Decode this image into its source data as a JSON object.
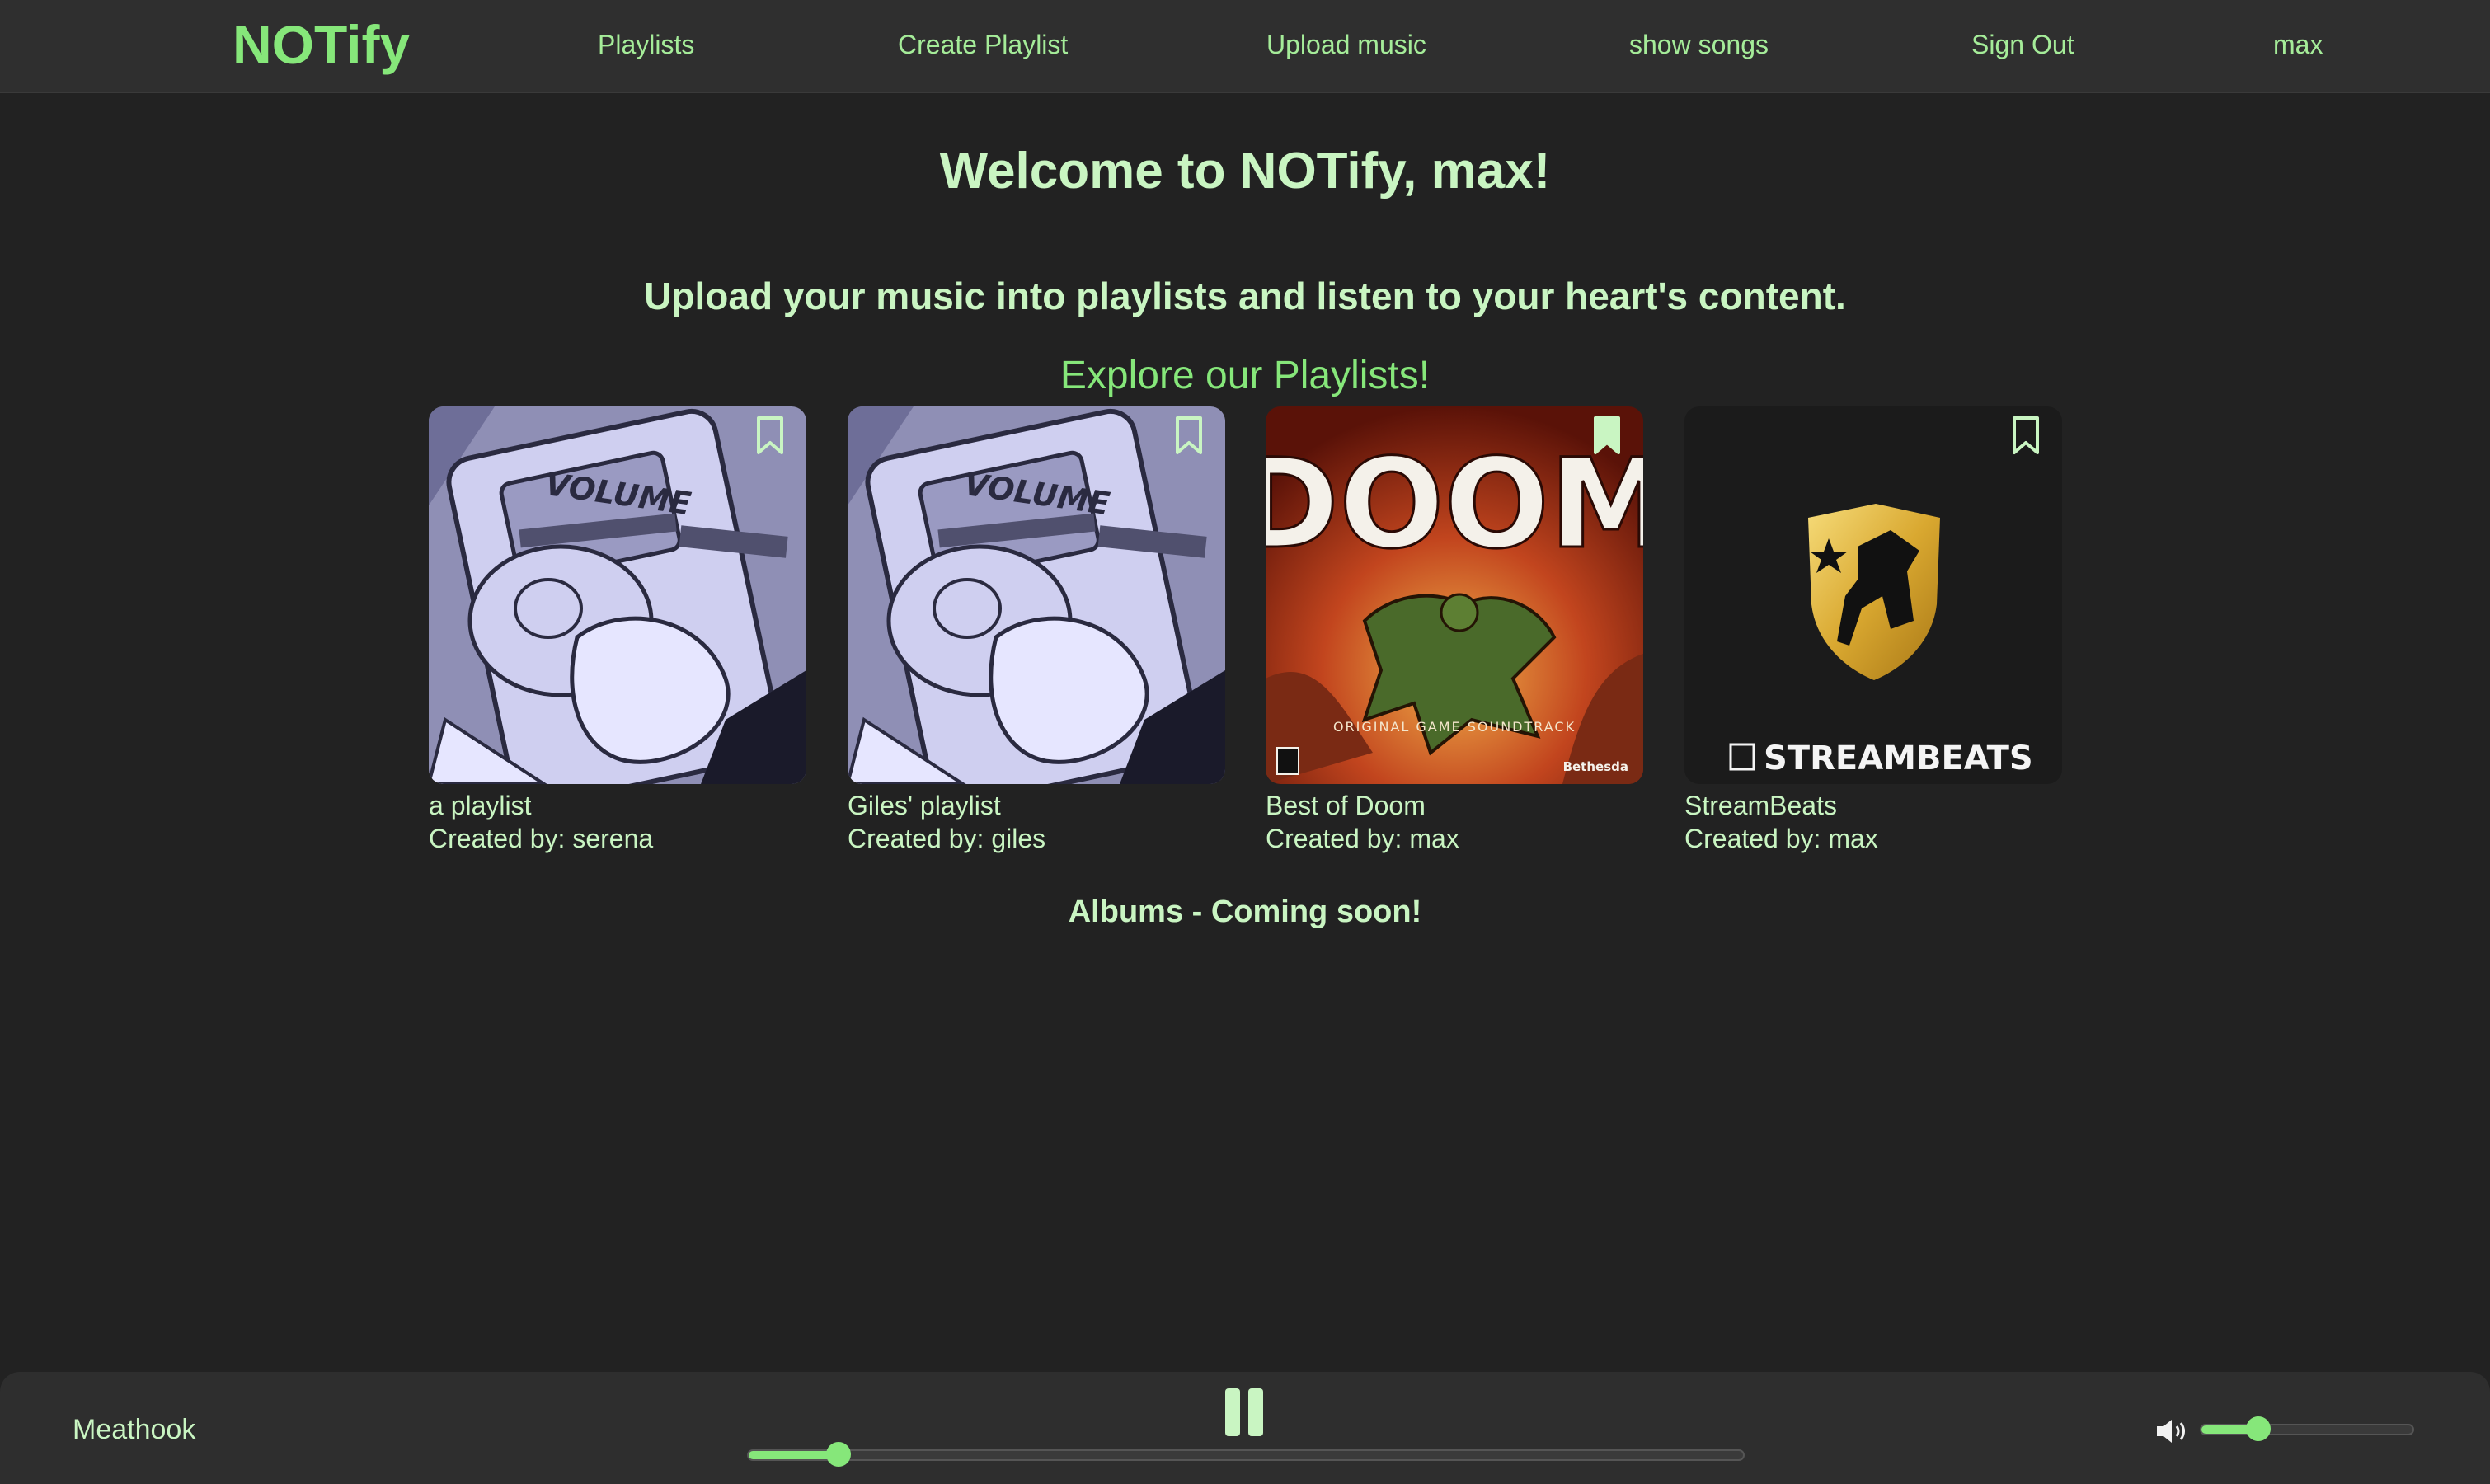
{
  "nav": {
    "brand": "NOTify",
    "links": [
      "Playlists",
      "Create Playlist",
      "Upload music",
      "show songs",
      "Sign Out",
      "max"
    ]
  },
  "main": {
    "welcome": "Welcome to NOTify, max!",
    "tagline": "Upload your music into playlists and listen to your heart's content.",
    "explore": "Explore our Playlists!",
    "albums": "Albums - Coming soon!"
  },
  "playlists": [
    {
      "title": "a playlist",
      "creator": "Created by: serena",
      "cover": "cartoon-music-player",
      "bookmarked": false
    },
    {
      "title": "Giles' playlist",
      "creator": "Created by: giles",
      "cover": "cartoon-music-player",
      "bookmarked": false
    },
    {
      "title": "Best of Doom",
      "creator": "Created by: max",
      "cover": "doom-soundtrack-art",
      "bookmarked": true
    },
    {
      "title": "StreamBeats",
      "creator": "Created by: max",
      "cover": "streambeats-logo",
      "bookmarked": false
    }
  ],
  "cover_text": {
    "volume": "VOLUME",
    "doom": "DOOM",
    "doom_subtitle": "ORIGINAL GAME SOUNDTRACK",
    "bethesda": "Bethesda",
    "streambeats": "STREAMBEATS"
  },
  "player": {
    "now_playing": "Meathook",
    "progress": 0.09,
    "volume": 0.27,
    "state": "playing"
  },
  "colors": {
    "accent": "#86e77a",
    "text": "#c9f5c2",
    "background": "#222222",
    "navbar": "#2f2f2f"
  }
}
